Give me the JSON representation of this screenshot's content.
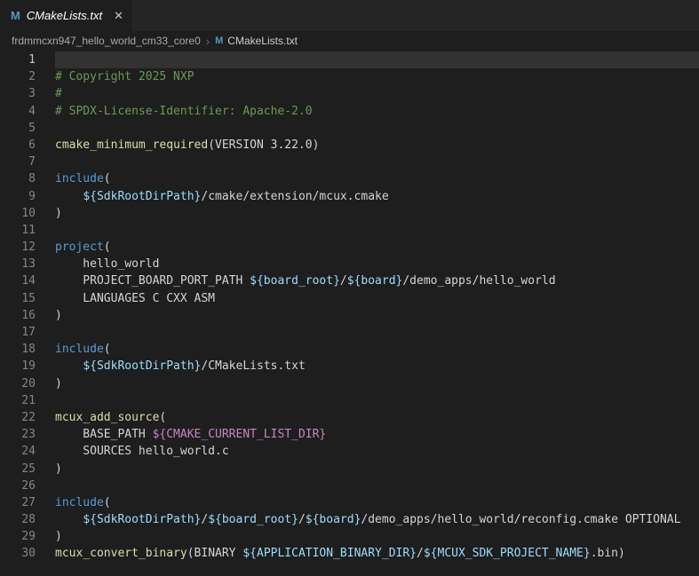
{
  "tab_bar": {
    "active_tab": {
      "label": "CMakeLists.txt",
      "icon": "M",
      "close_glyph": "✕"
    }
  },
  "breadcrumb": {
    "folder": "frdmmcxn947_hello_world_cm33_core0",
    "separator": "›",
    "file_icon": "M",
    "file": "CMakeLists.txt"
  },
  "colors": {
    "editor_bg": "#1e1e1e",
    "tabbar_bg": "#252526",
    "active_line_highlight": "#323232",
    "comment": "#6a9955",
    "keyword": "#569cd6",
    "function": "#dcdcaa",
    "variable": "#9cdcfe",
    "builtin_variable": "#c586c0",
    "default_text": "#d4d4d4",
    "line_number": "#858585",
    "cmake_icon": "#519aba"
  },
  "editor": {
    "language": "cmake",
    "active_line": 1,
    "lines": [
      {
        "n": 1,
        "tokens": []
      },
      {
        "n": 2,
        "tokens": [
          {
            "t": "# Copyright 2025 NXP",
            "c": "comment"
          }
        ]
      },
      {
        "n": 3,
        "tokens": [
          {
            "t": "#",
            "c": "comment"
          }
        ]
      },
      {
        "n": 4,
        "tokens": [
          {
            "t": "# SPDX-License-Identifier: Apache-2.0",
            "c": "comment"
          }
        ]
      },
      {
        "n": 5,
        "tokens": []
      },
      {
        "n": 6,
        "tokens": [
          {
            "t": "cmake_minimum_required",
            "c": "function"
          },
          {
            "t": "(VERSION 3.22.0)",
            "c": "default"
          }
        ]
      },
      {
        "n": 7,
        "tokens": []
      },
      {
        "n": 8,
        "tokens": [
          {
            "t": "include",
            "c": "keyword"
          },
          {
            "t": "(",
            "c": "default"
          }
        ]
      },
      {
        "n": 9,
        "tokens": [
          {
            "t": "    ",
            "c": "default"
          },
          {
            "t": "${SdkRootDirPath}",
            "c": "variable"
          },
          {
            "t": "/cmake/extension/mcux.cmake",
            "c": "default"
          }
        ]
      },
      {
        "n": 10,
        "tokens": [
          {
            "t": ")",
            "c": "default"
          }
        ]
      },
      {
        "n": 11,
        "tokens": []
      },
      {
        "n": 12,
        "tokens": [
          {
            "t": "project",
            "c": "keyword"
          },
          {
            "t": "(",
            "c": "default"
          }
        ]
      },
      {
        "n": 13,
        "tokens": [
          {
            "t": "    hello_world",
            "c": "default"
          }
        ]
      },
      {
        "n": 14,
        "tokens": [
          {
            "t": "    PROJECT_BOARD_PORT_PATH ",
            "c": "default"
          },
          {
            "t": "${board_root}",
            "c": "variable"
          },
          {
            "t": "/",
            "c": "default"
          },
          {
            "t": "${board}",
            "c": "variable"
          },
          {
            "t": "/demo_apps/hello_world",
            "c": "default"
          }
        ]
      },
      {
        "n": 15,
        "tokens": [
          {
            "t": "    LANGUAGES C CXX ASM",
            "c": "default"
          }
        ]
      },
      {
        "n": 16,
        "tokens": [
          {
            "t": ")",
            "c": "default"
          }
        ]
      },
      {
        "n": 17,
        "tokens": []
      },
      {
        "n": 18,
        "tokens": [
          {
            "t": "include",
            "c": "keyword"
          },
          {
            "t": "(",
            "c": "default"
          }
        ]
      },
      {
        "n": 19,
        "tokens": [
          {
            "t": "    ",
            "c": "default"
          },
          {
            "t": "${SdkRootDirPath}",
            "c": "variable"
          },
          {
            "t": "/CMakeLists.txt",
            "c": "default"
          }
        ]
      },
      {
        "n": 20,
        "tokens": [
          {
            "t": ")",
            "c": "default"
          }
        ]
      },
      {
        "n": 21,
        "tokens": []
      },
      {
        "n": 22,
        "tokens": [
          {
            "t": "mcux_add_source",
            "c": "function"
          },
          {
            "t": "(",
            "c": "default"
          }
        ]
      },
      {
        "n": 23,
        "tokens": [
          {
            "t": "    BASE_PATH ",
            "c": "default"
          },
          {
            "t": "${CMAKE_CURRENT_LIST_DIR}",
            "c": "builtin"
          }
        ]
      },
      {
        "n": 24,
        "tokens": [
          {
            "t": "    SOURCES hello_world.c",
            "c": "default"
          }
        ]
      },
      {
        "n": 25,
        "tokens": [
          {
            "t": ")",
            "c": "default"
          }
        ]
      },
      {
        "n": 26,
        "tokens": []
      },
      {
        "n": 27,
        "tokens": [
          {
            "t": "include",
            "c": "keyword"
          },
          {
            "t": "(",
            "c": "default"
          }
        ]
      },
      {
        "n": 28,
        "tokens": [
          {
            "t": "    ",
            "c": "default"
          },
          {
            "t": "${SdkRootDirPath}",
            "c": "variable"
          },
          {
            "t": "/",
            "c": "default"
          },
          {
            "t": "${board_root}",
            "c": "variable"
          },
          {
            "t": "/",
            "c": "default"
          },
          {
            "t": "${board}",
            "c": "variable"
          },
          {
            "t": "/demo_apps/hello_world/reconfig.cmake OPTIONAL",
            "c": "default"
          }
        ]
      },
      {
        "n": 29,
        "tokens": [
          {
            "t": ")",
            "c": "default"
          }
        ]
      },
      {
        "n": 30,
        "tokens": [
          {
            "t": "mcux_convert_binary",
            "c": "function"
          },
          {
            "t": "(BINARY ",
            "c": "default"
          },
          {
            "t": "${APPLICATION_BINARY_DIR}",
            "c": "variable"
          },
          {
            "t": "/",
            "c": "default"
          },
          {
            "t": "${MCUX_SDK_PROJECT_NAME}",
            "c": "variable"
          },
          {
            "t": ".bin)",
            "c": "default"
          }
        ]
      }
    ]
  }
}
